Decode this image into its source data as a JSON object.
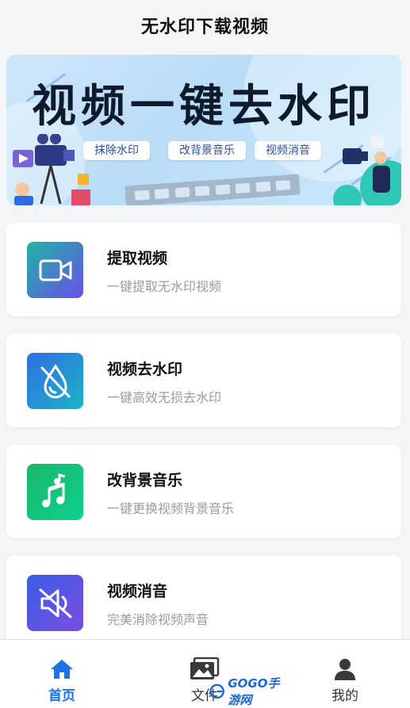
{
  "header": {
    "title": "无水印下载视频"
  },
  "banner": {
    "headline": "视频一键去水印",
    "chips": [
      "抹除水印",
      "改背景音乐",
      "视频消音"
    ]
  },
  "cards": [
    {
      "title": "提取视频",
      "subtitle": "一键提取无水印视频",
      "icon": "video-camera-icon",
      "gradient": [
        "#1fb6a4",
        "#6a4ee8"
      ]
    },
    {
      "title": "视频去水印",
      "subtitle": "一键高效无损去水印",
      "icon": "no-water-drop-icon",
      "gradient": [
        "#2f6fe0",
        "#1cb4c8"
      ]
    },
    {
      "title": "改背景音乐",
      "subtitle": "一键更换视频背景音乐",
      "icon": "music-notes-icon",
      "gradient": [
        "#19b86a",
        "#0fd08e"
      ]
    },
    {
      "title": "视频消音",
      "subtitle": "完美消除视频声音",
      "icon": "mute-speaker-icon",
      "gradient": [
        "#3a5ee8",
        "#7b4de0"
      ]
    }
  ],
  "bottom_nav": {
    "items": [
      {
        "label": "首页",
        "icon": "home-icon",
        "active": true
      },
      {
        "label": "文件",
        "icon": "gallery-icon",
        "active": false
      },
      {
        "label": "我的",
        "icon": "user-icon",
        "active": false
      }
    ],
    "active_color": "#1a73e8"
  },
  "watermark": {
    "text": "GOGO手游网"
  }
}
